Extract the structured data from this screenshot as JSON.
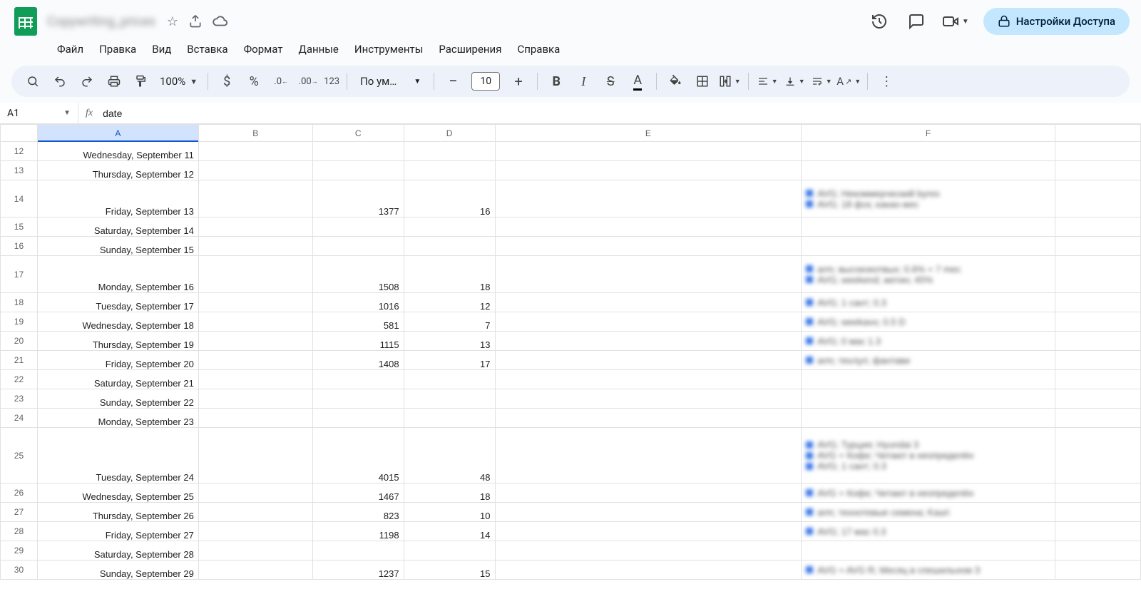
{
  "app": {
    "doc_title": "Copywriting_prices",
    "share_label": "Настройки Доступа"
  },
  "menubar": [
    "Файл",
    "Правка",
    "Вид",
    "Вставка",
    "Формат",
    "Данные",
    "Инструменты",
    "Расширения",
    "Справка"
  ],
  "toolbar": {
    "zoom": "100%",
    "font_name": "По ум…",
    "font_size": "10"
  },
  "formula_bar": {
    "cell_ref": "A1",
    "fx_label": "fx",
    "formula": "date"
  },
  "columns": [
    "A",
    "B",
    "C",
    "D",
    "E",
    "F"
  ],
  "rows": [
    {
      "n": 12,
      "a": "Wednesday, September 11",
      "c": "",
      "d": "",
      "f": []
    },
    {
      "n": 13,
      "a": "Thursday, September 12",
      "c": "",
      "d": "",
      "f": []
    },
    {
      "n": 14,
      "a": "Friday, September 13",
      "c": "1377",
      "d": "16",
      "tall": true,
      "f": [
        "AVG; Некоммерческий byres",
        "AVG; 18 фск; какао-жес"
      ]
    },
    {
      "n": 15,
      "a": "Saturday, September 14",
      "c": "",
      "d": "",
      "f": []
    },
    {
      "n": 16,
      "a": "Sunday, September 15",
      "c": "",
      "d": "",
      "f": []
    },
    {
      "n": 17,
      "a": "Monday, September 16",
      "c": "1508",
      "d": "18",
      "tall": true,
      "f": [
        "arm; высококотвых; 0.6% + 7 mес",
        "AVG; weekend; жетин; 45%"
      ]
    },
    {
      "n": 18,
      "a": "Tuesday, September 17",
      "c": "1016",
      "d": "12",
      "f": [
        "AVG; 1 сант; 0.3"
      ]
    },
    {
      "n": 19,
      "a": "Wednesday, September 18",
      "c": "581",
      "d": "7",
      "f": [
        "AVG; weekavo; 0.5 D"
      ]
    },
    {
      "n": 20,
      "a": "Thursday, September 19",
      "c": "1115",
      "d": "13",
      "f": [
        "AVG; 0 мас 1.3"
      ]
    },
    {
      "n": 21,
      "a": "Friday, September 20",
      "c": "1408",
      "d": "17",
      "f": [
        "arm; техлул; фантави"
      ]
    },
    {
      "n": 22,
      "a": "Saturday, September 21",
      "c": "",
      "d": "",
      "f": []
    },
    {
      "n": 23,
      "a": "Sunday, September 22",
      "c": "",
      "d": "",
      "f": []
    },
    {
      "n": 24,
      "a": "Monday, September 23",
      "c": "",
      "d": "",
      "f": []
    },
    {
      "n": 25,
      "a": "Tuesday, September 24",
      "c": "4015",
      "d": "48",
      "tall2": true,
      "f": [
        "AVG; Турция; Hyundai 3",
        "AVG + Кофе; Читают в неопределён",
        "AVG; 1 сант; 0.3"
      ]
    },
    {
      "n": 26,
      "a": "Wednesday, September 25",
      "c": "1467",
      "d": "18",
      "f": [
        "AVG + Кофе; Читают в неопределён"
      ]
    },
    {
      "n": 27,
      "a": "Thursday, September 26",
      "c": "823",
      "d": "10",
      "f": [
        "arm; технотевые семена; Kauri"
      ]
    },
    {
      "n": 28,
      "a": "Friday, September 27",
      "c": "1198",
      "d": "14",
      "f": [
        "AVG; 17 мас 0.3"
      ]
    },
    {
      "n": 29,
      "a": "Saturday, September 28",
      "c": "",
      "d": "",
      "f": []
    },
    {
      "n": 30,
      "a": "Sunday, September 29",
      "c": "1237",
      "d": "15",
      "f": [
        "AVG + AVG R; Месяц в спешильном З"
      ]
    }
  ]
}
